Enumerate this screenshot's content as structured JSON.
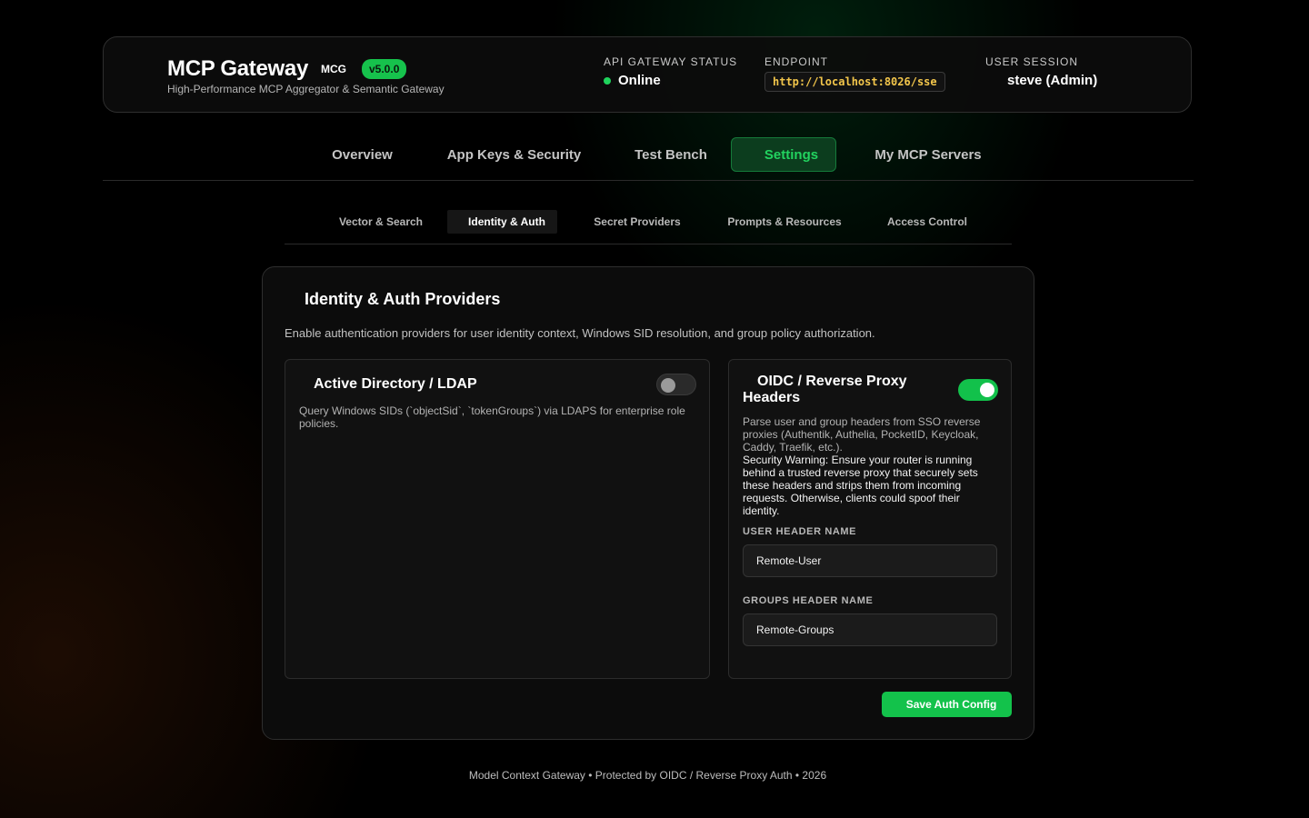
{
  "header": {
    "title": "MCP Gateway",
    "short_name": "MCG",
    "version": "v5.0.0",
    "subtitle": "High-Performance MCP Aggregator & Semantic Gateway",
    "status": {
      "label": "API GATEWAY STATUS",
      "value": "Online",
      "color": "#1fd35c"
    },
    "endpoint": {
      "label": "ENDPOINT",
      "value": "http://localhost:8026/sse"
    },
    "session": {
      "label": "USER SESSION",
      "value": "steve (Admin)"
    }
  },
  "main_tabs": [
    {
      "label": "Overview",
      "active": false
    },
    {
      "label": "App Keys & Security",
      "active": false
    },
    {
      "label": "Test Bench",
      "active": false
    },
    {
      "label": "Settings",
      "active": true
    },
    {
      "label": "My MCP Servers",
      "active": false
    }
  ],
  "sub_tabs": [
    {
      "label": "Vector & Search",
      "active": false
    },
    {
      "label": "Identity & Auth",
      "active": true
    },
    {
      "label": "Secret Providers",
      "active": false
    },
    {
      "label": "Prompts & Resources",
      "active": false
    },
    {
      "label": "Access Control",
      "active": false
    }
  ],
  "panel": {
    "title": "Identity & Auth Providers",
    "description": "Enable authentication providers for user identity context, Windows SID resolution, and group policy authorization.",
    "ldap": {
      "title": "Active Directory / LDAP",
      "enabled": false,
      "description": "Query Windows SIDs (`objectSid`, `tokenGroups`) via LDAPS for enterprise role policies."
    },
    "oidc": {
      "title": "OIDC / Reverse Proxy Headers",
      "enabled": true,
      "description": "Parse user and group headers from SSO reverse proxies (Authentik, Authelia, PocketID, Keycloak, Caddy, Traefik, etc.).",
      "warning": "Security Warning: Ensure your router is running behind a trusted reverse proxy that securely sets these headers and strips them from incoming requests. Otherwise, clients could spoof their identity.",
      "user_header_label": "USER HEADER NAME",
      "user_header_value": "Remote-User",
      "groups_header_label": "GROUPS HEADER NAME",
      "groups_header_value": "Remote-Groups"
    },
    "save_label": "Save Auth Config"
  },
  "footer": "Model Context Gateway • Protected by OIDC / Reverse Proxy Auth • 2026",
  "colors": {
    "accent": "#13c24b",
    "endpoint_text": "#f3c64b",
    "active_tab_text": "#22d35f"
  }
}
